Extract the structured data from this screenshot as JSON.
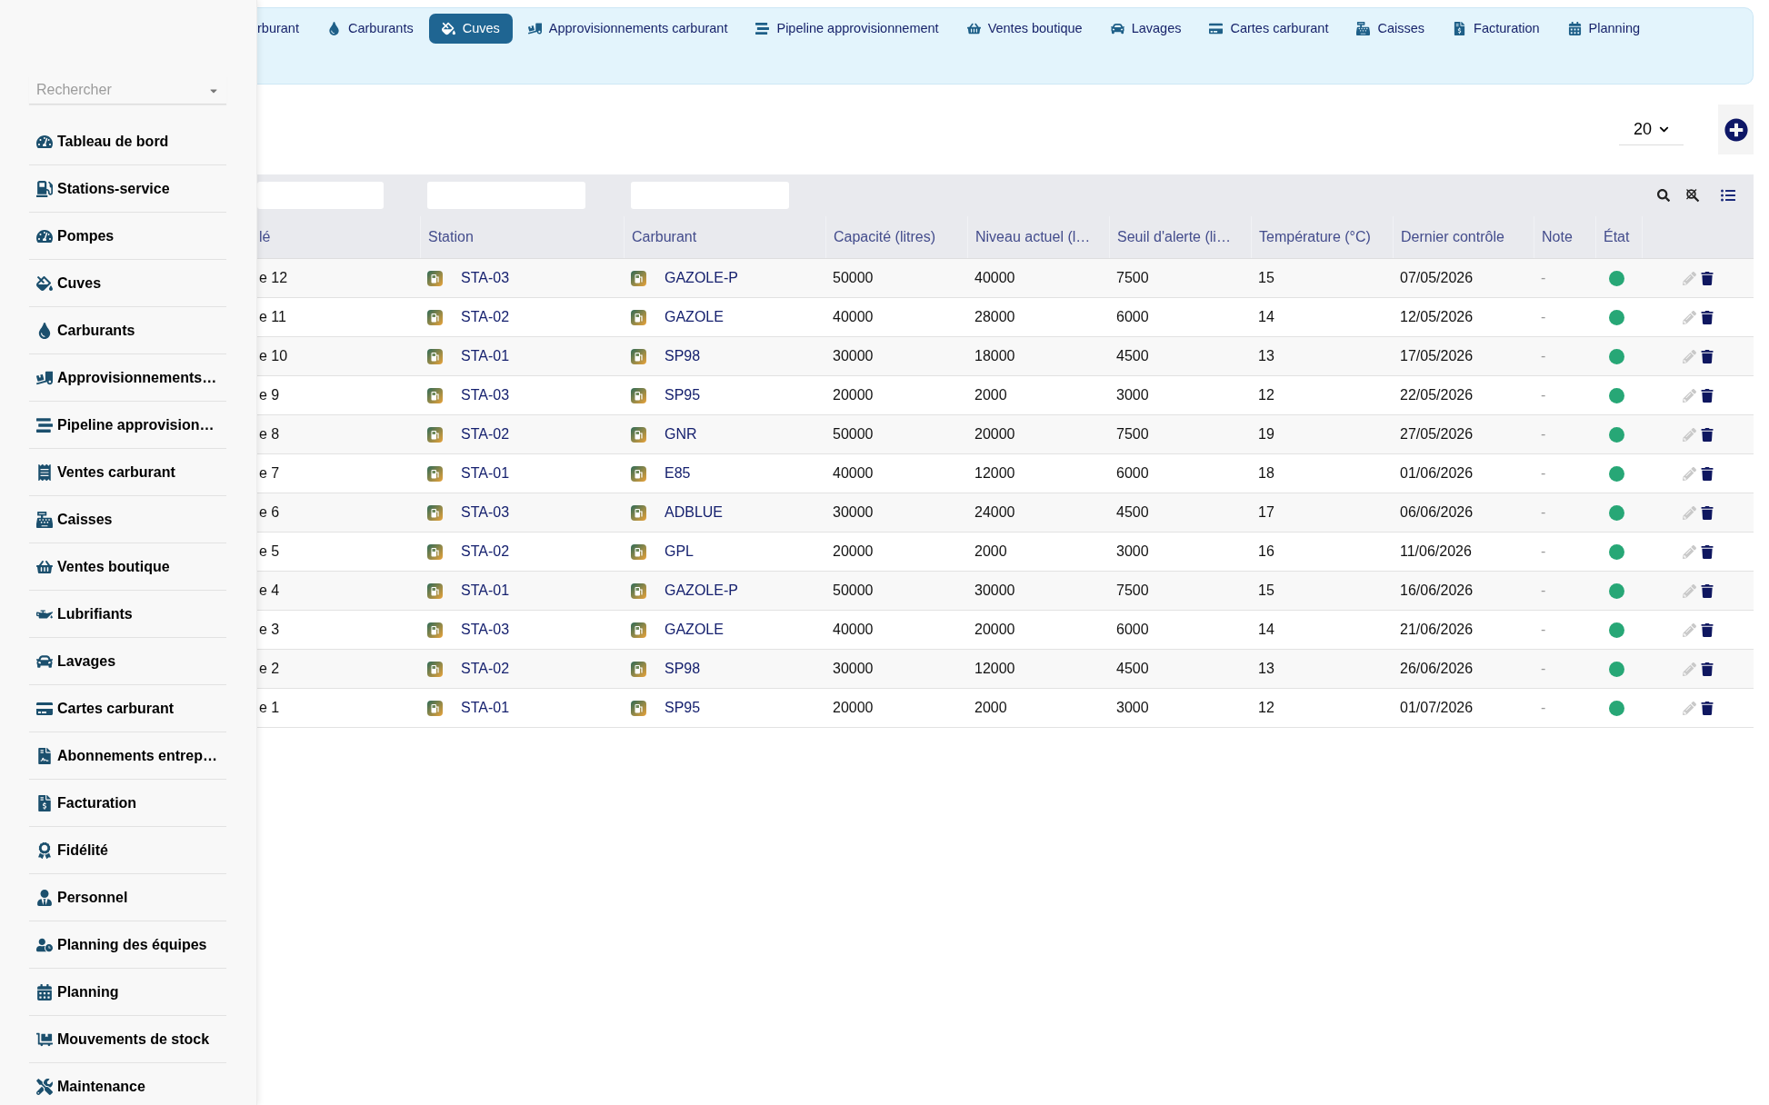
{
  "sidebar": {
    "search": {
      "placeholder": "Rechercher"
    },
    "items": [
      {
        "label": "Tableau de bord",
        "selected": false
      },
      {
        "label": "Stations-service",
        "selected": false
      },
      {
        "label": "Pompes",
        "selected": false
      },
      {
        "label": "Cuves",
        "selected": false
      },
      {
        "label": "Carburants",
        "selected": false
      },
      {
        "label": "Approvisionnements…",
        "selected": false
      },
      {
        "label": "Pipeline approvision…",
        "selected": false
      },
      {
        "label": "Ventes carburant",
        "selected": false
      },
      {
        "label": "Caisses",
        "selected": false
      },
      {
        "label": "Ventes boutique",
        "selected": false
      },
      {
        "label": "Lubrifiants",
        "selected": false
      },
      {
        "label": "Lavages",
        "selected": false
      },
      {
        "label": "Cartes carburant",
        "selected": false
      },
      {
        "label": "Abonnements entrep…",
        "selected": false
      },
      {
        "label": "Facturation",
        "selected": false
      },
      {
        "label": "Fidélité",
        "selected": false
      },
      {
        "label": "Personnel",
        "selected": false
      },
      {
        "label": "Planning des équipes",
        "selected": false
      },
      {
        "label": "Planning",
        "selected": false
      },
      {
        "label": "Mouvements de stock",
        "selected": false
      },
      {
        "label": "Maintenance",
        "selected": false
      }
    ]
  },
  "nav_tabs": [
    {
      "label": "rburant",
      "selected": false
    },
    {
      "label": "Carburants",
      "selected": false
    },
    {
      "label": "Cuves",
      "selected": true
    },
    {
      "label": "Approvisionnements carburant",
      "selected": false
    },
    {
      "label": "Pipeline approvisionnement",
      "selected": false
    },
    {
      "label": "Ventes boutique",
      "selected": false
    },
    {
      "label": "Lavages",
      "selected": false
    },
    {
      "label": "Cartes carburant",
      "selected": false
    },
    {
      "label": "Caisses",
      "selected": false
    },
    {
      "label": "Facturation",
      "selected": false
    },
    {
      "label": "Planning",
      "selected": false
    }
  ],
  "toolbar": {
    "page_size": "20"
  },
  "table": {
    "columns": [
      {
        "label": "lé",
        "kind": "text",
        "filter": true
      },
      {
        "label": "Station",
        "kind": "link",
        "filter": true
      },
      {
        "label": "Carburant",
        "kind": "link",
        "filter": true
      },
      {
        "label": "Capacité (litres)",
        "kind": "text",
        "filter": false
      },
      {
        "label": "Niveau actuel (l…",
        "kind": "text",
        "filter": false
      },
      {
        "label": "Seuil d'alerte (li…",
        "kind": "text",
        "filter": false
      },
      {
        "label": "Température (°C)",
        "kind": "text",
        "filter": false
      },
      {
        "label": "Dernier contrôle",
        "kind": "text",
        "filter": false
      },
      {
        "label": "Note",
        "kind": "muted",
        "filter": false
      },
      {
        "label": "État",
        "kind": "status",
        "filter": false
      }
    ],
    "rows": [
      {
        "cells": [
          "e 12",
          "STA-03",
          "GAZOLE-P",
          "50000",
          "40000",
          "7500",
          "15",
          "07/05/2026",
          "-"
        ],
        "color": "#27a776"
      },
      {
        "cells": [
          "e 11",
          "STA-02",
          "GAZOLE",
          "40000",
          "28000",
          "6000",
          "14",
          "12/05/2026",
          "-"
        ],
        "color": "#27a776"
      },
      {
        "cells": [
          "e 10",
          "STA-01",
          "SP98",
          "30000",
          "18000",
          "4500",
          "13",
          "17/05/2026",
          "-"
        ],
        "color": "#27a776"
      },
      {
        "cells": [
          "e 9",
          "STA-03",
          "SP95",
          "20000",
          "2000",
          "3000",
          "12",
          "22/05/2026",
          "-"
        ],
        "color": "#27a776"
      },
      {
        "cells": [
          "e 8",
          "STA-02",
          "GNR",
          "50000",
          "20000",
          "7500",
          "19",
          "27/05/2026",
          "-"
        ],
        "color": "#27a776"
      },
      {
        "cells": [
          "e 7",
          "STA-01",
          "E85",
          "40000",
          "12000",
          "6000",
          "18",
          "01/06/2026",
          "-"
        ],
        "color": "#27a776"
      },
      {
        "cells": [
          "e 6",
          "STA-03",
          "ADBLUE",
          "30000",
          "24000",
          "4500",
          "17",
          "06/06/2026",
          "-"
        ],
        "color": "#27a776"
      },
      {
        "cells": [
          "e 5",
          "STA-02",
          "GPL",
          "20000",
          "2000",
          "3000",
          "16",
          "11/06/2026",
          "-"
        ],
        "color": "#27a776"
      },
      {
        "cells": [
          "e 4",
          "STA-01",
          "GAZOLE-P",
          "50000",
          "30000",
          "7500",
          "15",
          "16/06/2026",
          "-"
        ],
        "color": "#27a776"
      },
      {
        "cells": [
          "e 3",
          "STA-03",
          "GAZOLE",
          "40000",
          "20000",
          "6000",
          "14",
          "21/06/2026",
          "-"
        ],
        "color": "#27a776"
      },
      {
        "cells": [
          "e 2",
          "STA-02",
          "SP98",
          "30000",
          "12000",
          "4500",
          "13",
          "26/06/2026",
          "-"
        ],
        "color": "#27a776"
      },
      {
        "cells": [
          "e 1",
          "STA-01",
          "SP95",
          "20000",
          "2000",
          "3000",
          "12",
          "01/07/2026",
          "-"
        ],
        "color": "#27a776"
      }
    ]
  }
}
